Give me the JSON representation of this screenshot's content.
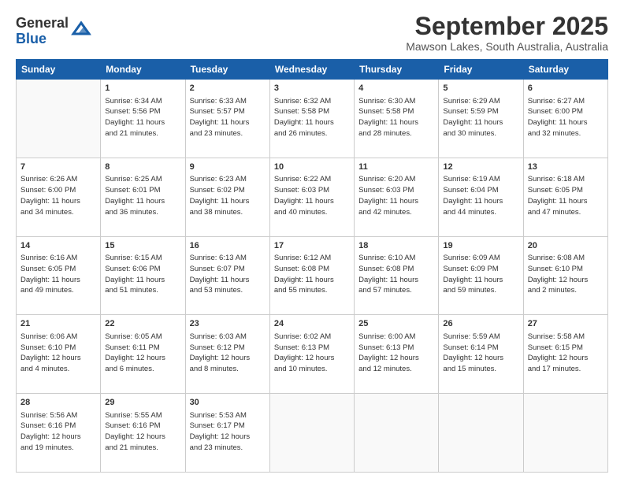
{
  "logo": {
    "line1": "General",
    "line2": "Blue"
  },
  "title": "September 2025",
  "subtitle": "Mawson Lakes, South Australia, Australia",
  "days": [
    "Sunday",
    "Monday",
    "Tuesday",
    "Wednesday",
    "Thursday",
    "Friday",
    "Saturday"
  ],
  "weeks": [
    [
      {
        "day": "",
        "content": ""
      },
      {
        "day": "1",
        "content": "Sunrise: 6:34 AM\nSunset: 5:56 PM\nDaylight: 11 hours\nand 21 minutes."
      },
      {
        "day": "2",
        "content": "Sunrise: 6:33 AM\nSunset: 5:57 PM\nDaylight: 11 hours\nand 23 minutes."
      },
      {
        "day": "3",
        "content": "Sunrise: 6:32 AM\nSunset: 5:58 PM\nDaylight: 11 hours\nand 26 minutes."
      },
      {
        "day": "4",
        "content": "Sunrise: 6:30 AM\nSunset: 5:58 PM\nDaylight: 11 hours\nand 28 minutes."
      },
      {
        "day": "5",
        "content": "Sunrise: 6:29 AM\nSunset: 5:59 PM\nDaylight: 11 hours\nand 30 minutes."
      },
      {
        "day": "6",
        "content": "Sunrise: 6:27 AM\nSunset: 6:00 PM\nDaylight: 11 hours\nand 32 minutes."
      }
    ],
    [
      {
        "day": "7",
        "content": "Sunrise: 6:26 AM\nSunset: 6:00 PM\nDaylight: 11 hours\nand 34 minutes."
      },
      {
        "day": "8",
        "content": "Sunrise: 6:25 AM\nSunset: 6:01 PM\nDaylight: 11 hours\nand 36 minutes."
      },
      {
        "day": "9",
        "content": "Sunrise: 6:23 AM\nSunset: 6:02 PM\nDaylight: 11 hours\nand 38 minutes."
      },
      {
        "day": "10",
        "content": "Sunrise: 6:22 AM\nSunset: 6:03 PM\nDaylight: 11 hours\nand 40 minutes."
      },
      {
        "day": "11",
        "content": "Sunrise: 6:20 AM\nSunset: 6:03 PM\nDaylight: 11 hours\nand 42 minutes."
      },
      {
        "day": "12",
        "content": "Sunrise: 6:19 AM\nSunset: 6:04 PM\nDaylight: 11 hours\nand 44 minutes."
      },
      {
        "day": "13",
        "content": "Sunrise: 6:18 AM\nSunset: 6:05 PM\nDaylight: 11 hours\nand 47 minutes."
      }
    ],
    [
      {
        "day": "14",
        "content": "Sunrise: 6:16 AM\nSunset: 6:05 PM\nDaylight: 11 hours\nand 49 minutes."
      },
      {
        "day": "15",
        "content": "Sunrise: 6:15 AM\nSunset: 6:06 PM\nDaylight: 11 hours\nand 51 minutes."
      },
      {
        "day": "16",
        "content": "Sunrise: 6:13 AM\nSunset: 6:07 PM\nDaylight: 11 hours\nand 53 minutes."
      },
      {
        "day": "17",
        "content": "Sunrise: 6:12 AM\nSunset: 6:08 PM\nDaylight: 11 hours\nand 55 minutes."
      },
      {
        "day": "18",
        "content": "Sunrise: 6:10 AM\nSunset: 6:08 PM\nDaylight: 11 hours\nand 57 minutes."
      },
      {
        "day": "19",
        "content": "Sunrise: 6:09 AM\nSunset: 6:09 PM\nDaylight: 11 hours\nand 59 minutes."
      },
      {
        "day": "20",
        "content": "Sunrise: 6:08 AM\nSunset: 6:10 PM\nDaylight: 12 hours\nand 2 minutes."
      }
    ],
    [
      {
        "day": "21",
        "content": "Sunrise: 6:06 AM\nSunset: 6:10 PM\nDaylight: 12 hours\nand 4 minutes."
      },
      {
        "day": "22",
        "content": "Sunrise: 6:05 AM\nSunset: 6:11 PM\nDaylight: 12 hours\nand 6 minutes."
      },
      {
        "day": "23",
        "content": "Sunrise: 6:03 AM\nSunset: 6:12 PM\nDaylight: 12 hours\nand 8 minutes."
      },
      {
        "day": "24",
        "content": "Sunrise: 6:02 AM\nSunset: 6:13 PM\nDaylight: 12 hours\nand 10 minutes."
      },
      {
        "day": "25",
        "content": "Sunrise: 6:00 AM\nSunset: 6:13 PM\nDaylight: 12 hours\nand 12 minutes."
      },
      {
        "day": "26",
        "content": "Sunrise: 5:59 AM\nSunset: 6:14 PM\nDaylight: 12 hours\nand 15 minutes."
      },
      {
        "day": "27",
        "content": "Sunrise: 5:58 AM\nSunset: 6:15 PM\nDaylight: 12 hours\nand 17 minutes."
      }
    ],
    [
      {
        "day": "28",
        "content": "Sunrise: 5:56 AM\nSunset: 6:16 PM\nDaylight: 12 hours\nand 19 minutes."
      },
      {
        "day": "29",
        "content": "Sunrise: 5:55 AM\nSunset: 6:16 PM\nDaylight: 12 hours\nand 21 minutes."
      },
      {
        "day": "30",
        "content": "Sunrise: 5:53 AM\nSunset: 6:17 PM\nDaylight: 12 hours\nand 23 minutes."
      },
      {
        "day": "",
        "content": ""
      },
      {
        "day": "",
        "content": ""
      },
      {
        "day": "",
        "content": ""
      },
      {
        "day": "",
        "content": ""
      }
    ]
  ]
}
